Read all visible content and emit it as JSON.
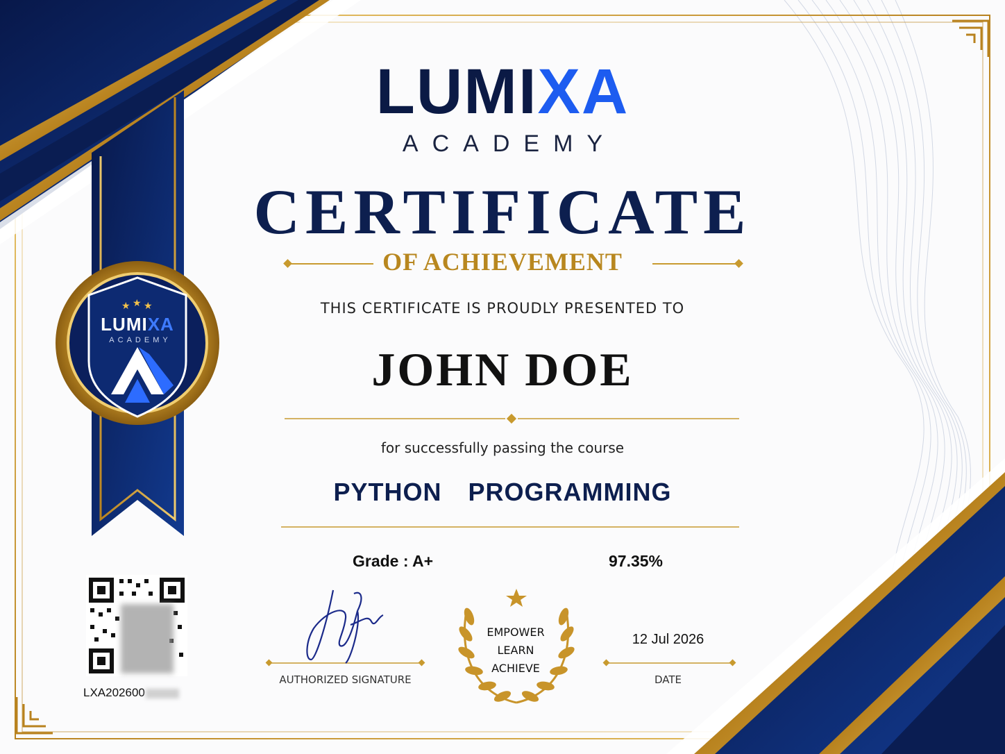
{
  "brand": {
    "logo_main": "LUMI",
    "logo_accent": "XA",
    "logo_sub": "ACADEMY"
  },
  "certificate": {
    "title": "CERTIFICATE",
    "subtitle": "OF ACHIEVEMENT",
    "presented_to": "THIS CERTIFICATE IS PROUDLY PRESENTED TO",
    "recipient_name": "JOHN DOE",
    "passing_text": "for successfully passing the course",
    "course_name": "PYTHON  PROGRAMMING",
    "grade": "Grade : A+",
    "score": "97.35%",
    "signature_label": "AUTHORIZED SIGNATURE",
    "date_value": "12 Jul 2026",
    "date_label": "DATE",
    "certificate_id": "LXA202600"
  },
  "emblem": {
    "line1": "EMPOWER",
    "line2": "LEARN",
    "line3": "ACHIEVE"
  },
  "seal": {
    "logo_main": "LUMI",
    "logo_accent": "XA",
    "logo_sub": "ACADEMY"
  },
  "colors": {
    "navy": "#0b1f5c",
    "gold": "#c89a2e",
    "accent_blue": "#1d5cf0"
  }
}
